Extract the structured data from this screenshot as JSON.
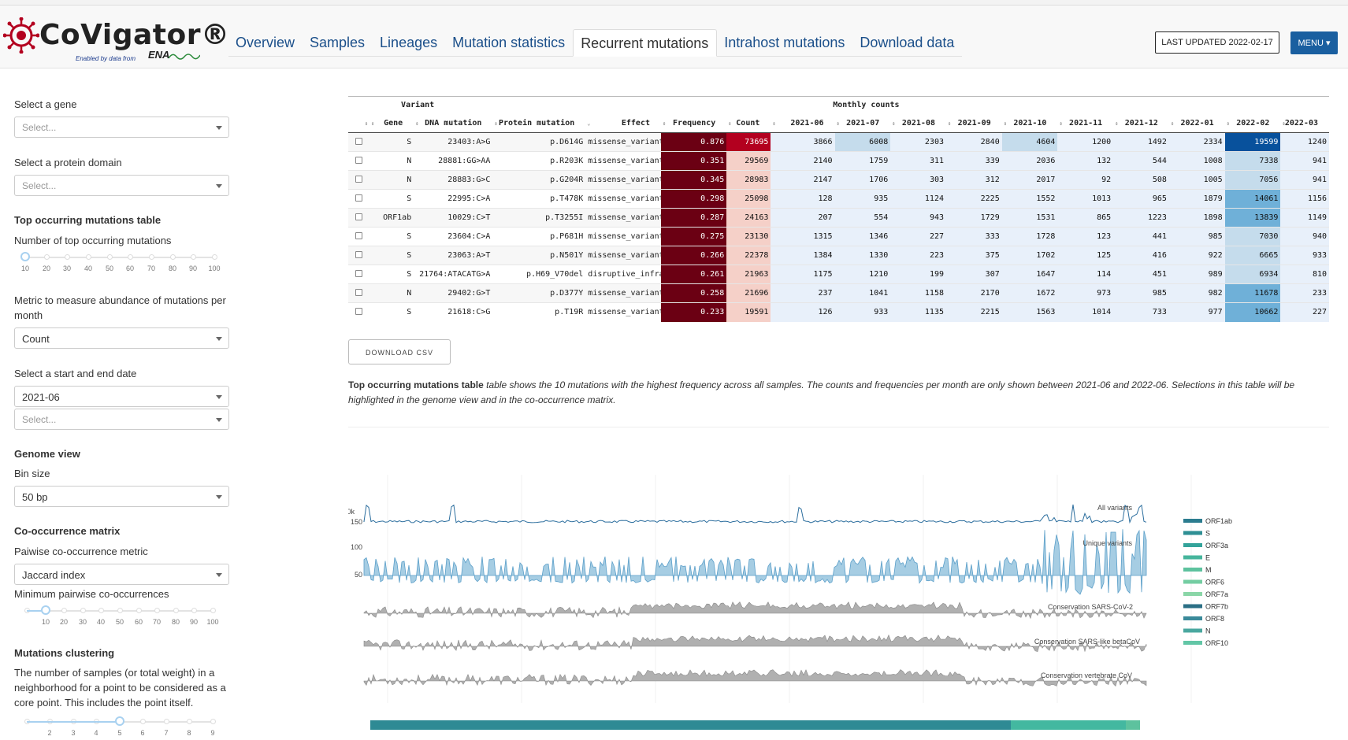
{
  "header": {
    "app_title": "CoVigator®",
    "logo_sub": "Enabled by data from",
    "logo_ena": "ENA",
    "nav": [
      "Overview",
      "Samples",
      "Lineages",
      "Mutation statistics",
      "Recurrent mutations",
      "Intrahost mutations",
      "Download data"
    ],
    "active_tab": "Recurrent mutations",
    "last_updated": "LAST UPDATED 2022-02-17",
    "menu": "MENU ▾"
  },
  "sidebar": {
    "gene_label": "Select a gene",
    "gene_placeholder": "Select...",
    "domain_label": "Select a protein domain",
    "domain_placeholder": "Select...",
    "top_table_heading": "Top occurring mutations table",
    "num_top_label": "Number of top occurring mutations",
    "num_top_ticks": [
      "10",
      "20",
      "30",
      "40",
      "50",
      "60",
      "70",
      "80",
      "90",
      "100"
    ],
    "num_top_value": 10,
    "metric_label": "Metric to measure abundance of mutations per month",
    "metric_value": "Count",
    "date_label": "Select a start and end date",
    "start_date": "2021-06",
    "end_date_placeholder": "Select...",
    "genome_heading": "Genome view",
    "bin_label": "Bin size",
    "bin_value": "50 bp",
    "cooc_heading": "Co-occurrence matrix",
    "cooc_metric_label": "Paiwise co-occurrence metric",
    "cooc_metric_value": "Jaccard index",
    "min_cooc_label": "Minimum pairwise co-occurrences",
    "min_cooc_ticks": [
      "10",
      "20",
      "30",
      "40",
      "50",
      "60",
      "70",
      "80",
      "90",
      "100"
    ],
    "min_cooc_value": 10,
    "clustering_heading": "Mutations clustering",
    "clustering_text": "The number of samples (or total weight) in a neighborhood for a point to be considered as a core point. This includes the point itself.",
    "clustering_ticks": [
      "2",
      "3",
      "4",
      "5",
      "6",
      "7",
      "8",
      "9"
    ],
    "clustering_value": 5
  },
  "table": {
    "group_variant": "Variant",
    "group_monthly": "Monthly counts",
    "columns": [
      "Gene",
      "DNA mutation",
      "Protein mutation",
      "Effect",
      "Frequency",
      "Count",
      "2021-06",
      "2021-07",
      "2021-08",
      "2021-09",
      "2021-10",
      "2021-11",
      "2021-12",
      "2022-01",
      "2022-02",
      "2022-03"
    ],
    "rows": [
      [
        "S",
        "23403:A>G",
        "p.D614G",
        "missense_variant",
        "0.876",
        "73695",
        "3866",
        "6008",
        "2303",
        "2840",
        "4604",
        "1200",
        "1492",
        "2334",
        "19599",
        "1240"
      ],
      [
        "N",
        "28881:GG>AA",
        "p.R203K",
        "missense_variant",
        "0.351",
        "29569",
        "2140",
        "1759",
        "311",
        "339",
        "2036",
        "132",
        "544",
        "1008",
        "7338",
        "941"
      ],
      [
        "N",
        "28883:G>C",
        "p.G204R",
        "missense_variant",
        "0.345",
        "28983",
        "2147",
        "1706",
        "303",
        "312",
        "2017",
        "92",
        "508",
        "1005",
        "7056",
        "941"
      ],
      [
        "S",
        "22995:C>A",
        "p.T478K",
        "missense_variant",
        "0.298",
        "25098",
        "128",
        "935",
        "1124",
        "2225",
        "1552",
        "1013",
        "965",
        "1879",
        "14061",
        "1156"
      ],
      [
        "ORF1ab",
        "10029:C>T",
        "p.T3255I",
        "missense_variant",
        "0.287",
        "24163",
        "207",
        "554",
        "943",
        "1729",
        "1531",
        "865",
        "1223",
        "1898",
        "13839",
        "1149"
      ],
      [
        "S",
        "23604:C>A",
        "p.P681H",
        "missense_variant",
        "0.275",
        "23130",
        "1315",
        "1346",
        "227",
        "333",
        "1728",
        "123",
        "441",
        "985",
        "7030",
        "940"
      ],
      [
        "S",
        "23063:A>T",
        "p.N501Y",
        "missense_variant",
        "0.266",
        "22378",
        "1384",
        "1330",
        "223",
        "375",
        "1702",
        "125",
        "416",
        "922",
        "6665",
        "933"
      ],
      [
        "S",
        "21764:ATACATG>A",
        "p.H69_V70del",
        "disruptive_infra",
        "0.261",
        "21963",
        "1175",
        "1210",
        "199",
        "307",
        "1647",
        "114",
        "451",
        "989",
        "6934",
        "810"
      ],
      [
        "N",
        "29402:G>T",
        "p.D377Y",
        "missense_variant",
        "0.258",
        "21696",
        "237",
        "1041",
        "1158",
        "2170",
        "1672",
        "973",
        "985",
        "982",
        "11678",
        "233"
      ],
      [
        "S",
        "21618:C>G",
        "p.T19R",
        "missense_variant",
        "0.233",
        "19591",
        "126",
        "933",
        "1135",
        "2215",
        "1563",
        "1014",
        "733",
        "977",
        "10662",
        "227"
      ]
    ]
  },
  "download_csv": "DOWNLOAD CSV",
  "caption": {
    "bold": "Top occurring mutations table",
    "text": " table shows the 10 mutations with the highest frequency across all samples. The counts and frequencies per month are only shown between 2021-06 and 2022-06. Selections in this table will be highlighted in the genome view and in the co-occurrence matrix."
  },
  "genome_plot": {
    "track_labels": [
      "All variants",
      "Unique variants",
      "Conservation SARS-CoV-2",
      "Conservation SARS-like betaCoV",
      "Conservation vertebrate CoV"
    ],
    "y_ticks_all": [
      "50k"
    ],
    "y_ticks_unique": [
      "150",
      "100",
      "50"
    ],
    "legend": [
      "ORF1ab",
      "S",
      "ORF3a",
      "E",
      "M",
      "ORF6",
      "ORF7a",
      "ORF7b",
      "ORF8",
      "N",
      "ORF10"
    ],
    "colors": {
      "all_line": "#2c6e9e",
      "unique_line": "#5b9fc9",
      "unique_fill": "#a6cde3",
      "conservation": "#b0b0b0",
      "legend": [
        "#2b7c8f",
        "#2e8f94",
        "#33a39a",
        "#46b59c",
        "#5dc29e",
        "#74cda2",
        "#8ad6a7",
        "#2b6f85",
        "#3a8a9a",
        "#4aa79f",
        "#62c6a6"
      ],
      "domains": [
        "#2e8a94",
        "#43b8a0"
      ]
    }
  },
  "colors": {
    "freq_cell": "#6b0013",
    "count_dark": "#b3001f",
    "count_light": "#f5d0c8",
    "month_light": "#e8f0fa",
    "month_mid": "#c5dcec",
    "month_strong": "#6fb0d8",
    "month_max": "#08519c",
    "nav_link": "#1b4f8a",
    "menu_bg": "#1a5fa0"
  }
}
